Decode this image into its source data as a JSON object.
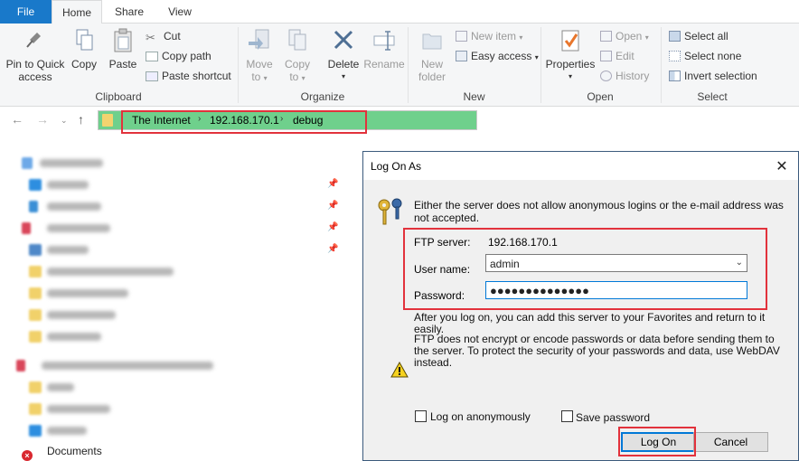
{
  "ribbon": {
    "tabs": [
      "File",
      "Home",
      "Share",
      "View"
    ],
    "clipboard": {
      "pin_label_1": "Pin to Quick",
      "pin_label_2": "access",
      "copy": "Copy",
      "paste": "Paste",
      "cut": "Cut",
      "copy_path": "Copy path",
      "paste_shortcut": "Paste shortcut",
      "group": "Clipboard"
    },
    "organize": {
      "move_to_1": "Move",
      "move_to_2": "to",
      "copy_to_1": "Copy",
      "copy_to_2": "to",
      "delete": "Delete",
      "rename": "Rename",
      "group": "Organize"
    },
    "new": {
      "new_folder_1": "New",
      "new_folder_2": "folder",
      "new_item": "New item",
      "easy_access": "Easy access",
      "group": "New"
    },
    "open": {
      "properties": "Properties",
      "open": "Open",
      "edit": "Edit",
      "history": "History",
      "group": "Open"
    },
    "select": {
      "select_all": "Select all",
      "select_none": "Select none",
      "invert_selection": "Invert selection",
      "group": "Select"
    }
  },
  "address": {
    "crumbs": [
      "The Internet",
      "192.168.170.1",
      "debug"
    ]
  },
  "navpane": {
    "last_item": "Documents"
  },
  "dialog": {
    "title": "Log On As",
    "message": "Either the server does not allow anonymous logins or the e-mail address was not accepted.",
    "ftp_server_label": "FTP server:",
    "ftp_server_value": "192.168.170.1",
    "username_label": "User name:",
    "username_value": "admin",
    "password_label": "Password:",
    "password_value": "●●●●●●●●●●●●●●",
    "after_logon_note": "After you log on, you can add this server to your Favorites and return to it easily.",
    "warning_note": "FTP does not encrypt or encode passwords or data before sending them to the server.  To protect the security of your passwords and data, use WebDAV instead.",
    "log_on_anonymously": "Log on anonymously",
    "save_password": "Save password",
    "log_on_button": "Log On",
    "cancel_button": "Cancel"
  },
  "colors": {
    "accent": "#1979ca",
    "address_highlight": "#6fd08c",
    "annotation_red": "#e2323c"
  }
}
